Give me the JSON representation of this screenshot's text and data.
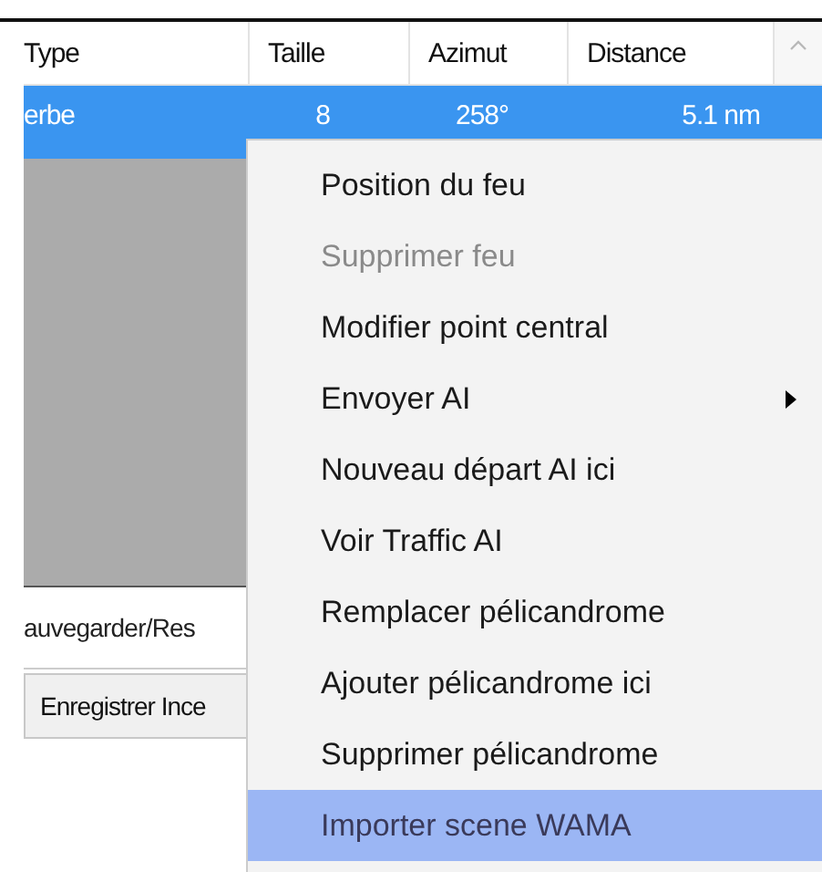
{
  "table": {
    "columns": [
      "Type",
      "Taille",
      "Azimut",
      "Distance"
    ],
    "rows": [
      {
        "cells": [
          "erbe",
          "8",
          "258°",
          "5.1 nm"
        ],
        "selected": true
      }
    ]
  },
  "panel": {
    "label": "auvegarder/Res",
    "button": "Enregistrer Ince"
  },
  "context_menu": {
    "items": [
      {
        "label": "Position du feu",
        "disabled": false,
        "has_submenu": false,
        "selected": false
      },
      {
        "label": "Supprimer feu",
        "disabled": true,
        "has_submenu": false,
        "selected": false
      },
      {
        "label": "Modifier point central",
        "disabled": false,
        "has_submenu": false,
        "selected": false
      },
      {
        "label": "Envoyer AI",
        "disabled": false,
        "has_submenu": true,
        "selected": false
      },
      {
        "label": "Nouveau départ AI ici",
        "disabled": false,
        "has_submenu": false,
        "selected": false
      },
      {
        "label": "Voir Traffic AI",
        "disabled": false,
        "has_submenu": false,
        "selected": false
      },
      {
        "label": "Remplacer pélicandrome",
        "disabled": false,
        "has_submenu": false,
        "selected": false
      },
      {
        "label": "Ajouter pélicandrome ici",
        "disabled": false,
        "has_submenu": false,
        "selected": false
      },
      {
        "label": "Supprimer pélicandrome",
        "disabled": false,
        "has_submenu": false,
        "selected": false
      },
      {
        "label": "Importer scene WAMA",
        "disabled": false,
        "has_submenu": false,
        "selected": true
      }
    ]
  }
}
